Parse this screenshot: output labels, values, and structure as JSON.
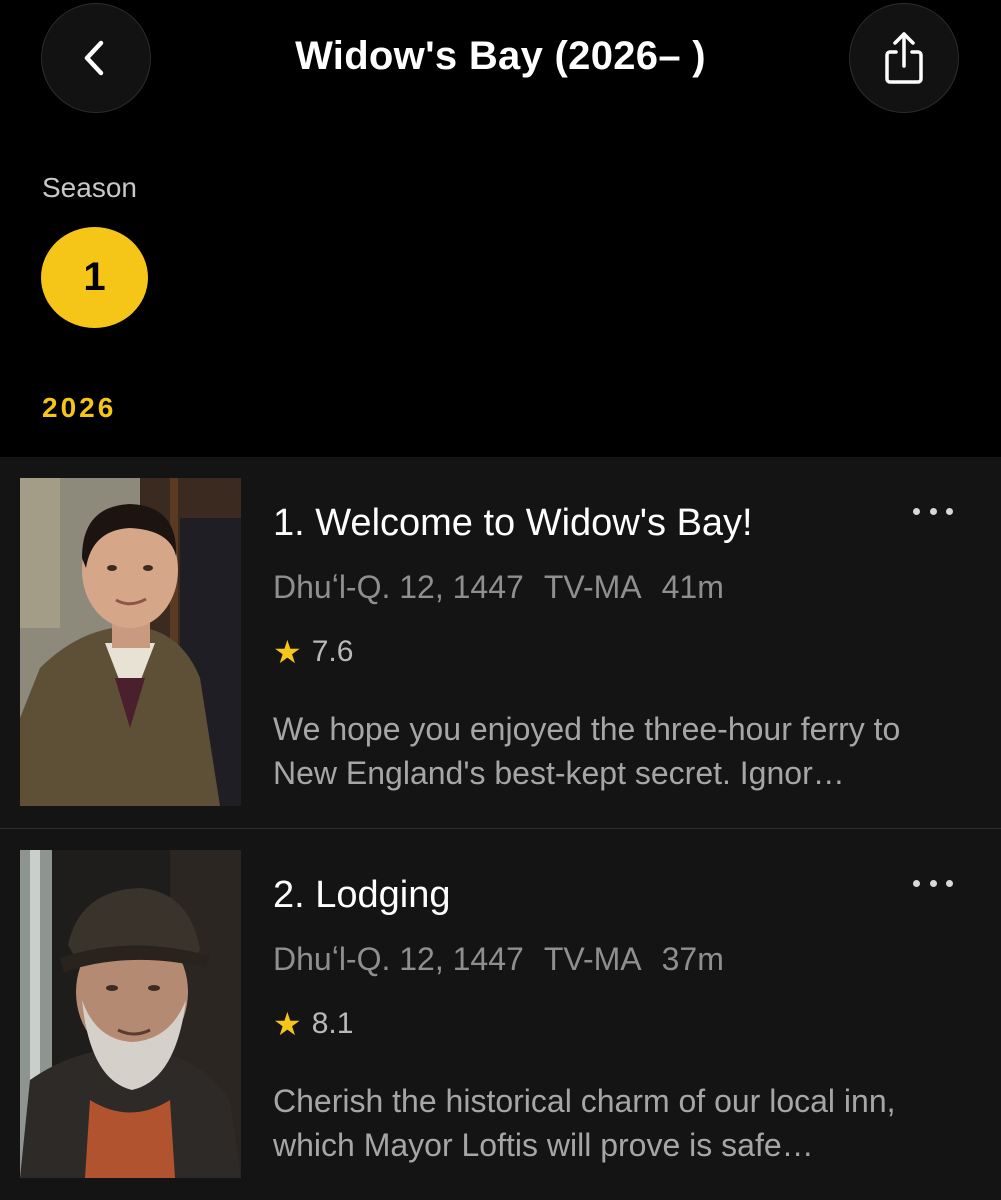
{
  "header": {
    "title": "Widow's Bay (2026– )",
    "back_icon": "chevron-left-icon",
    "share_icon": "share-icon"
  },
  "season": {
    "label": "Season",
    "selected": "1",
    "year": "2026"
  },
  "colors": {
    "accent": "#f5c518",
    "background": "#000000",
    "list_background": "#141414"
  },
  "episodes": [
    {
      "title": "1. Welcome to Widow's Bay!",
      "date": "Dhuʻl-Q. 12, 1447",
      "rating_label": "TV-MA",
      "runtime": "41m",
      "score": "7.6",
      "description": "We hope you enjoyed the three-hour ferry to New England's best-kept secret. Ignor…"
    },
    {
      "title": "2. Lodging",
      "date": "Dhuʻl-Q. 12, 1447",
      "rating_label": "TV-MA",
      "runtime": "37m",
      "score": "8.1",
      "description": "Cherish the historical charm of our local inn, which Mayor Loftis will prove is safe…"
    }
  ]
}
